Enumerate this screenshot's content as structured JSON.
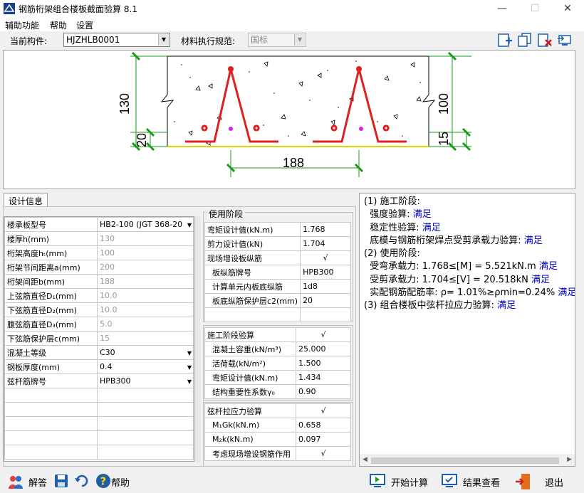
{
  "window": {
    "title": "钢筋桁架组合楼板截面验算 8.1",
    "minimize": "—",
    "maximize": "☐",
    "close": "✕"
  },
  "menu": [
    "辅助功能",
    "帮助",
    "设置"
  ],
  "toolbar": {
    "component_label": "当前构件:",
    "component_value": "HJZHLB0001",
    "code_label": "材料执行规范:",
    "code_value": "国标"
  },
  "drawing": {
    "dim_130": "130",
    "dim_20": "20",
    "dim_100": "100",
    "dim_15": "15",
    "dim_188": "188"
  },
  "design_tab": "设计信息",
  "design_params": [
    {
      "label": "楼承板型号",
      "value": "HB2-100 (JGT 368-20",
      "dropdown": true,
      "disabled": false
    },
    {
      "label": "楼厚h(mm)",
      "value": "130",
      "disabled": true
    },
    {
      "label": "桁架高度hₜ(mm)",
      "value": "100",
      "disabled": true
    },
    {
      "label": "桁架节间距离a(mm)",
      "value": "200",
      "disabled": true
    },
    {
      "label": "桁架间距b(mm)",
      "value": "188",
      "disabled": true
    },
    {
      "label": "上弦筋直径D₁(mm)",
      "value": "10.0",
      "disabled": true
    },
    {
      "label": "下弦筋直径D₂(mm)",
      "value": "10.0",
      "disabled": true
    },
    {
      "label": "腹弦筋直径D₃(mm)",
      "value": "5.0",
      "disabled": true
    },
    {
      "label": "下弦筋保护层c(mm)",
      "value": "15",
      "disabled": true
    },
    {
      "label": "混凝土等级",
      "value": "C30",
      "dropdown": true,
      "disabled": false
    },
    {
      "label": "钢板厚度(mm)",
      "value": "0.4",
      "dropdown": true,
      "disabled": false
    },
    {
      "label": "弦杆筋牌号",
      "value": "HPB300",
      "dropdown": true,
      "disabled": false
    }
  ],
  "use_stage": {
    "title": "使用阶段",
    "rows": [
      {
        "label": "弯矩设计值(kN.m)",
        "value": "1.768",
        "indent": false
      },
      {
        "label": "剪力设计值(kN)",
        "value": "1.704",
        "indent": false
      },
      {
        "label": "现场增设板纵筋",
        "value": "√",
        "indent": false,
        "check": true
      },
      {
        "label": "板纵筋牌号",
        "value": "HPB300",
        "indent": true
      },
      {
        "label": "计算单元内板底纵筋",
        "value": "1d8",
        "indent": true
      },
      {
        "label": "板底纵筋保护层c2(mm)",
        "value": "20",
        "indent": true
      }
    ]
  },
  "construction_stage": {
    "title": "施工阶段验算",
    "check": "√",
    "rows": [
      {
        "label": "混凝土容重(kN/m³)",
        "value": "25.000"
      },
      {
        "label": "活荷载(kN/m²)",
        "value": "1.500"
      },
      {
        "label": "弯矩设计值(kN.m)",
        "value": "1.434"
      },
      {
        "label": "结构重要性系数γ₀",
        "value": "0.90"
      }
    ]
  },
  "chord_stage": {
    "title": "弦杆拉应力验算",
    "check": "√",
    "rows": [
      {
        "label": "M₁Gk(kN.m)",
        "value": "0.658"
      },
      {
        "label": "M₂k(kN.m)",
        "value": "0.097"
      },
      {
        "label": "考虑现场增设钢筋作用",
        "value": "√"
      }
    ]
  },
  "results": [
    {
      "text": "(1) 施工阶段:",
      "ok": ""
    },
    {
      "text": "  强度验算:",
      "ok": "满足"
    },
    {
      "text": "  稳定性验算:",
      "ok": "满足"
    },
    {
      "text": "  底模与钢筋桁架焊点受剪承载力验算:",
      "ok": "满足"
    },
    {
      "text": "(2) 使用阶段:",
      "ok": ""
    },
    {
      "text": "  受弯承载力: 1.768≤[M] = 5.521kN.m",
      "ok": "满足"
    },
    {
      "text": "  受剪承载力: 1.704≤[V] = 20.518kN",
      "ok": "满足"
    },
    {
      "text": "  实配钢筋配筋率: ρ= 1.01%≥ρmin=0.24%",
      "ok": "满足"
    },
    {
      "text": "(3) 组合楼板中弦杆拉应力验算:",
      "ok": "满足"
    }
  ],
  "bottom": {
    "explain": "解答",
    "help": "帮助",
    "start": "开始计算",
    "view": "结果查看",
    "exit": "退出"
  }
}
